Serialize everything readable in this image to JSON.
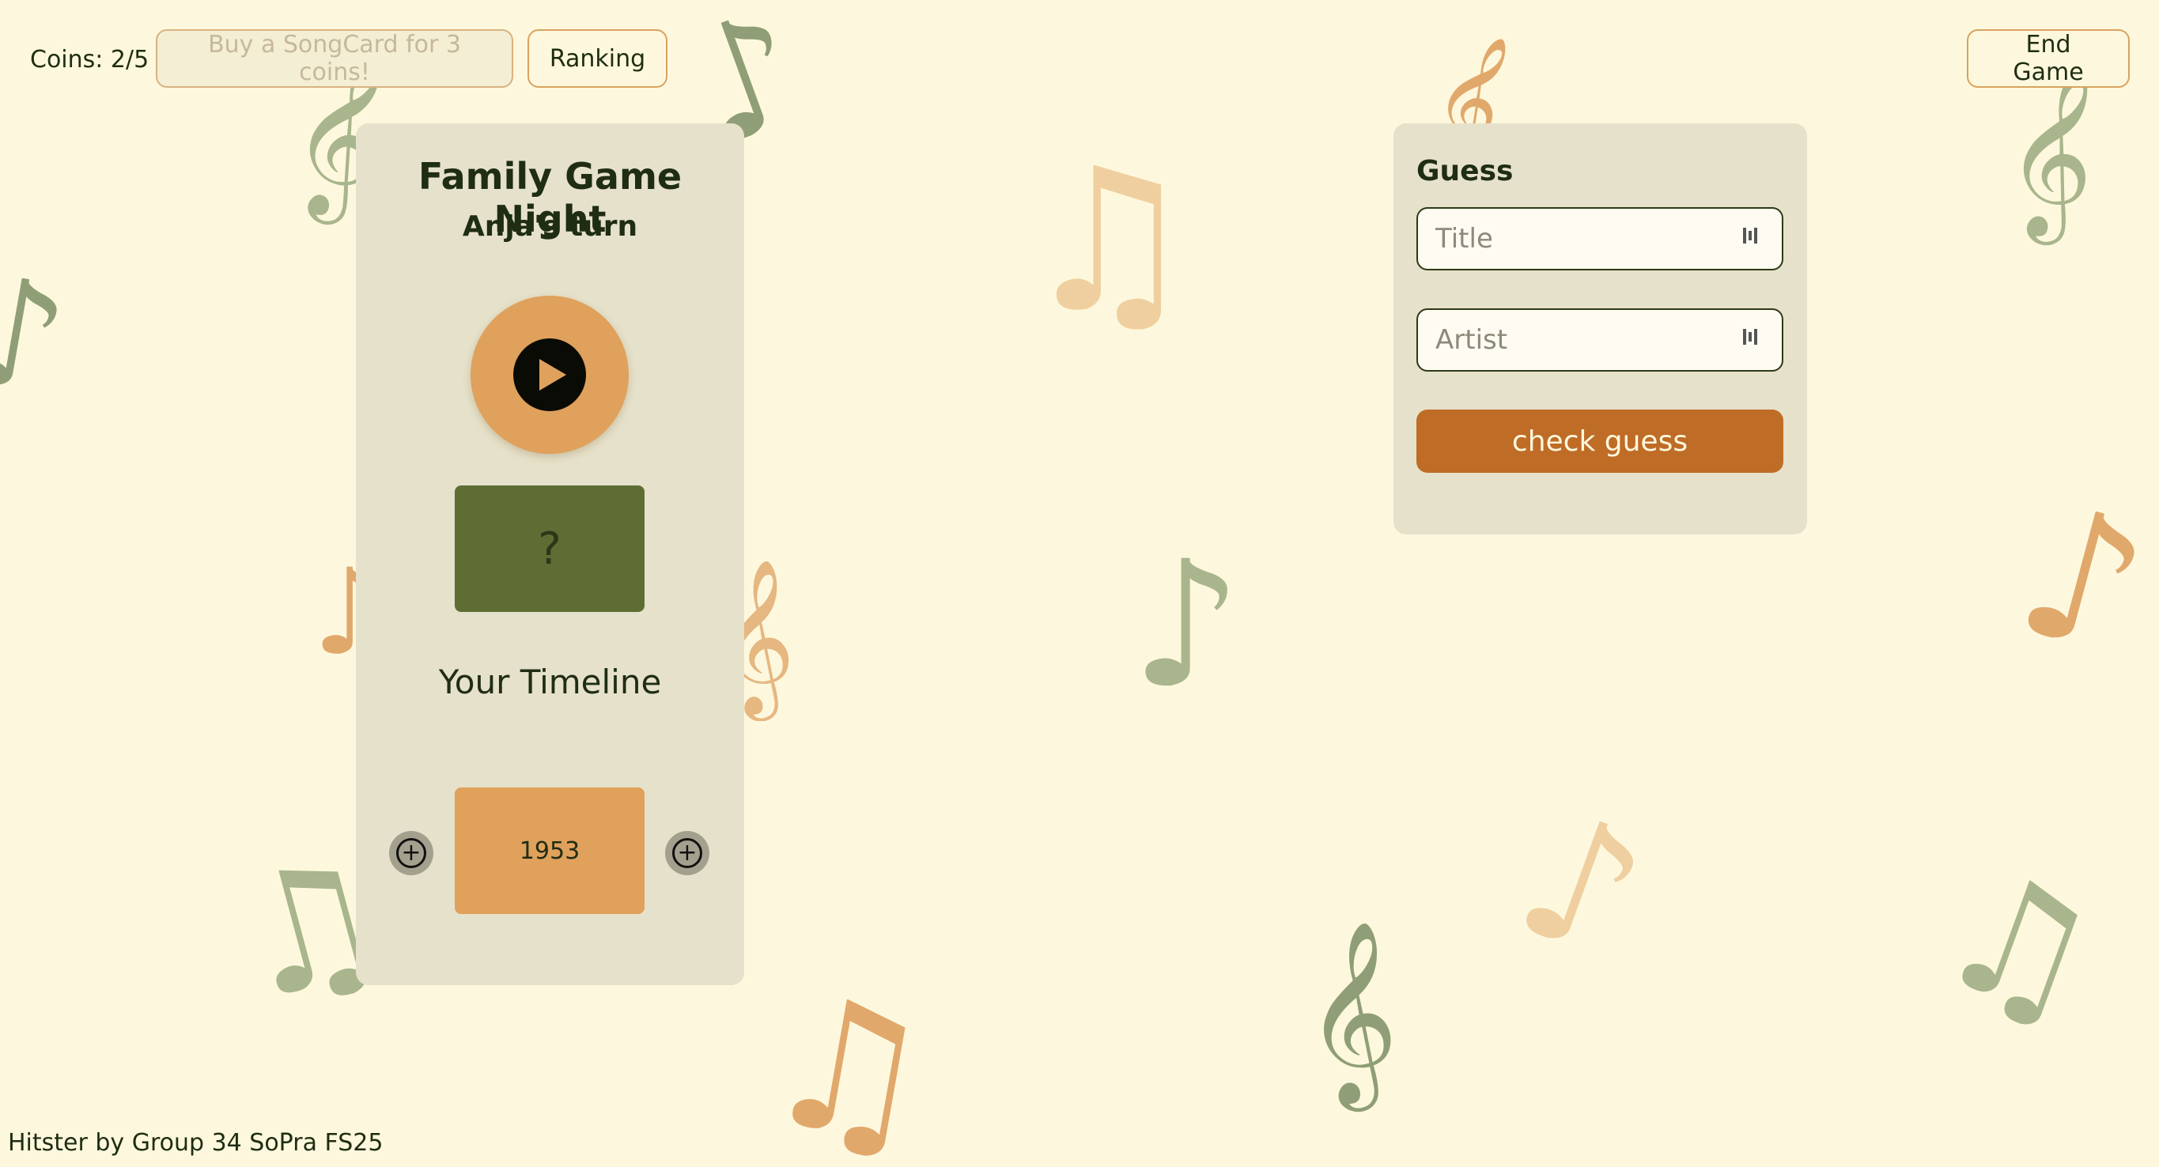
{
  "topbar": {
    "coins": "Coins: 2/5",
    "buy_label": "Buy a SongCard for 3 coins!",
    "ranking_label": "Ranking",
    "end_label": "End Game"
  },
  "game": {
    "title": "Family Game Night",
    "turn": "Anja's turn",
    "mystery_card": "?",
    "timeline_heading": "Your Timeline",
    "timeline": [
      {
        "year": "1953"
      }
    ]
  },
  "guess": {
    "heading": "Guess",
    "title_placeholder": "Title",
    "artist_placeholder": "Artist",
    "check_label": "check guess"
  },
  "footer": "Hitster by Group 34 SoPra FS25",
  "colors": {
    "background": "#fdf8dd",
    "panel": "#e6e1ca",
    "accent_orange": "#dfa15c",
    "check_button": "#bf6c27",
    "card_green": "#5e6d34",
    "text_dark": "#1f2d12"
  },
  "icons": [
    "play-icon",
    "plus-circle-icon",
    "password-manager-icon",
    "music-note-icon",
    "treble-clef-icon"
  ]
}
